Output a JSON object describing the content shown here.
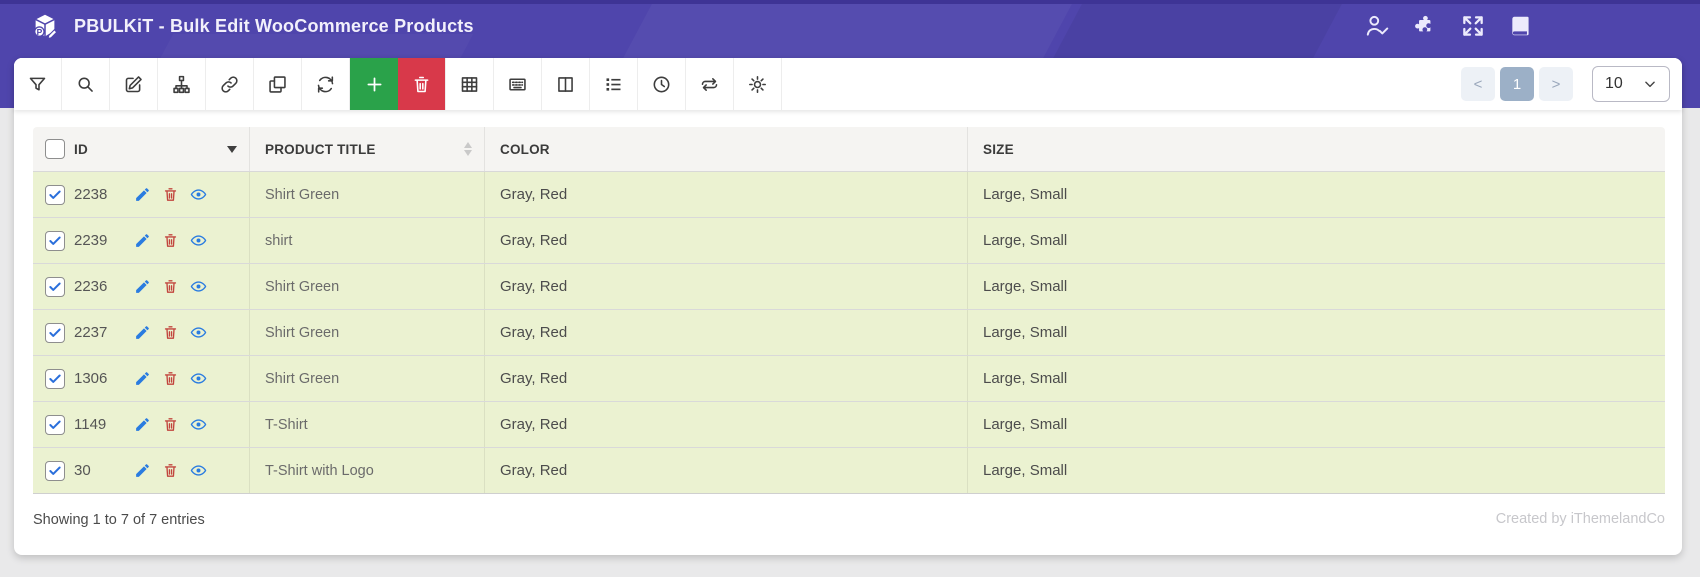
{
  "header": {
    "title": "PBULKiT - Bulk Edit WooCommerce Products",
    "logo_icon": "pbulkit-box-logo",
    "icons": [
      "user-check",
      "puzzle",
      "fullscreen",
      "book"
    ]
  },
  "toolbar": {
    "buttons": [
      {
        "name": "filter"
      },
      {
        "name": "search"
      },
      {
        "name": "edit"
      },
      {
        "name": "sitemap"
      },
      {
        "name": "link"
      },
      {
        "name": "duplicate"
      },
      {
        "name": "refresh"
      },
      {
        "name": "add",
        "variant": "green"
      },
      {
        "name": "delete",
        "variant": "red"
      },
      {
        "name": "table-grid"
      },
      {
        "name": "keyboard"
      },
      {
        "name": "split-columns"
      },
      {
        "name": "list"
      },
      {
        "name": "history"
      },
      {
        "name": "sync"
      },
      {
        "name": "settings"
      }
    ]
  },
  "pagination": {
    "prev": "<",
    "current": "1",
    "next": ">",
    "page_size": "10"
  },
  "table": {
    "columns": [
      "ID",
      "PRODUCT TITLE",
      "COLOR",
      "SIZE"
    ],
    "sort": {
      "id": "desc",
      "product_title": "none"
    },
    "select_all_checked": false,
    "rows": [
      {
        "checked": true,
        "id": "2238",
        "title": "Shirt Green",
        "color": "Gray, Red",
        "size": "Large, Small"
      },
      {
        "checked": true,
        "id": "2239",
        "title": "shirt",
        "color": "Gray, Red",
        "size": "Large, Small"
      },
      {
        "checked": true,
        "id": "2236",
        "title": "Shirt Green",
        "color": "Gray, Red",
        "size": "Large, Small"
      },
      {
        "checked": true,
        "id": "2237",
        "title": "Shirt Green",
        "color": "Gray, Red",
        "size": "Large, Small"
      },
      {
        "checked": true,
        "id": "1306",
        "title": "Shirt Green",
        "color": "Gray, Red",
        "size": "Large, Small"
      },
      {
        "checked": true,
        "id": "1149",
        "title": "T-Shirt",
        "color": "Gray, Red",
        "size": "Large, Small"
      },
      {
        "checked": true,
        "id": "30",
        "title": "T-Shirt with Logo",
        "color": "Gray, Red",
        "size": "Large, Small"
      }
    ],
    "row_actions": [
      "edit-pencil",
      "delete-trash",
      "view-eye"
    ]
  },
  "footer": {
    "showing": "Showing 1 to 7 of 7 entries",
    "credit": "Created by iThemelandCo"
  },
  "colors": {
    "header_purple": "#4f45ac",
    "add_green": "#2aa24a",
    "delete_red": "#d8394a",
    "row_green": "#ebf2d1",
    "current_page": "#9cb0c7",
    "action_blue": "#2a7ce0",
    "action_red": "#c2453d"
  }
}
